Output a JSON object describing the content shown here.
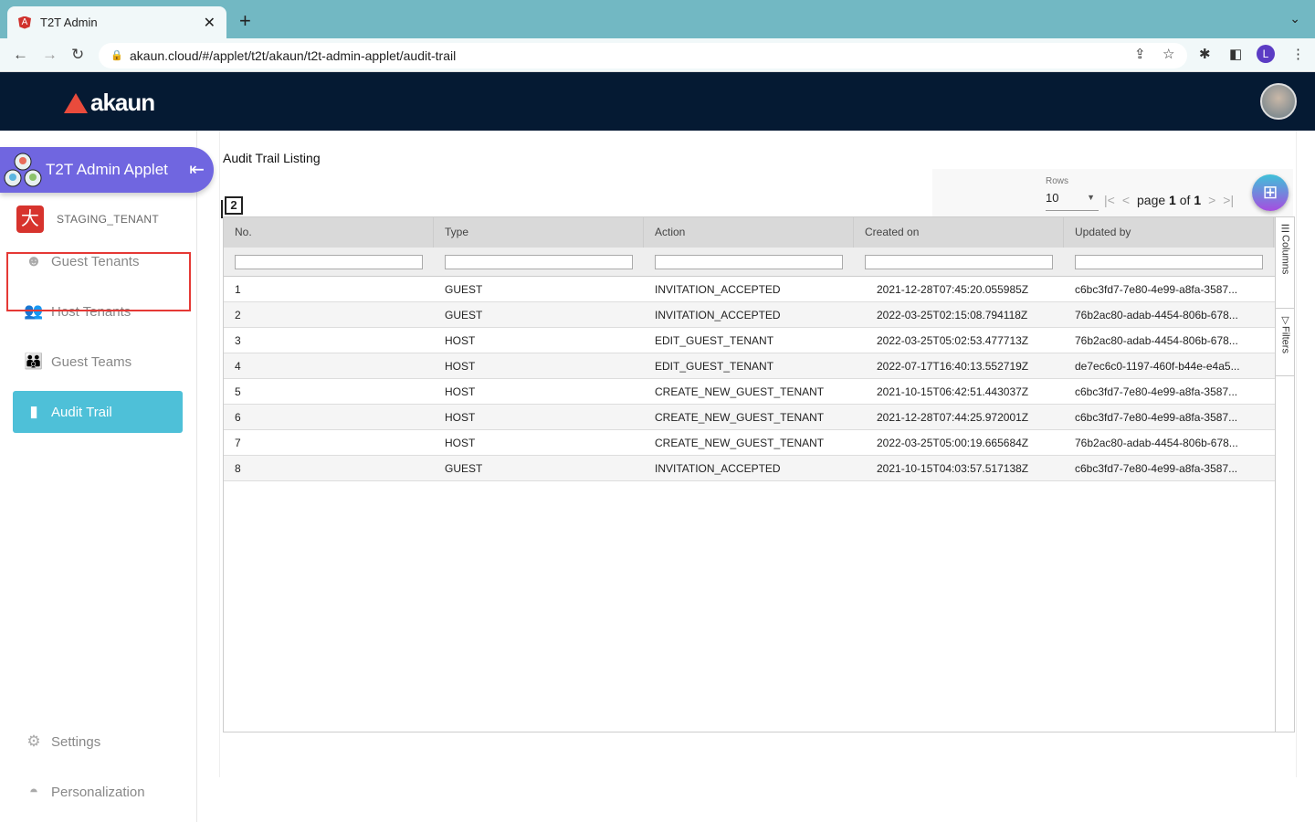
{
  "browser": {
    "tab_title": "T2T Admin",
    "url": "akaun.cloud/#/applet/t2t/akaun/t2t-admin-applet/audit-trail",
    "profile_initial": "L"
  },
  "header": {
    "logo_text": "akaun"
  },
  "sidebar": {
    "applet_title": "T2T Admin Applet",
    "tenant": "STAGING_TENANT",
    "items": [
      {
        "label": "Guest Tenants"
      },
      {
        "label": "Host Tenants"
      },
      {
        "label": "Guest Teams"
      },
      {
        "label": "Audit Trail"
      }
    ],
    "bottom": [
      {
        "label": "Settings"
      },
      {
        "label": "Personalization"
      }
    ]
  },
  "main": {
    "title": "Audit Trail Listing",
    "record_count": "2",
    "pager": {
      "rows_label": "Rows",
      "rows_value": "10",
      "page_label": "page",
      "page": "1",
      "of_label": "of",
      "total_pages": "1"
    },
    "columns": [
      "No.",
      "Type",
      "Action",
      "Created on",
      "Updated by"
    ],
    "side_panel": {
      "columns": "Columns",
      "filters": "Filters"
    },
    "rows": [
      [
        "1",
        "GUEST",
        "INVITATION_ACCEPTED",
        "2021-12-28T07:45:20.055985Z",
        "c6bc3fd7-7e80-4e99-a8fa-3587..."
      ],
      [
        "2",
        "GUEST",
        "INVITATION_ACCEPTED",
        "2022-03-25T02:15:08.794118Z",
        "76b2ac80-adab-4454-806b-678..."
      ],
      [
        "3",
        "HOST",
        "EDIT_GUEST_TENANT",
        "2022-03-25T05:02:53.477713Z",
        "76b2ac80-adab-4454-806b-678..."
      ],
      [
        "4",
        "HOST",
        "EDIT_GUEST_TENANT",
        "2022-07-17T16:40:13.552719Z",
        "de7ec6c0-1197-460f-b44e-e4a5..."
      ],
      [
        "5",
        "HOST",
        "CREATE_NEW_GUEST_TENANT",
        "2021-10-15T06:42:51.443037Z",
        "c6bc3fd7-7e80-4e99-a8fa-3587..."
      ],
      [
        "6",
        "HOST",
        "CREATE_NEW_GUEST_TENANT",
        "2021-12-28T07:44:25.972001Z",
        "c6bc3fd7-7e80-4e99-a8fa-3587..."
      ],
      [
        "7",
        "HOST",
        "CREATE_NEW_GUEST_TENANT",
        "2022-03-25T05:00:19.665684Z",
        "76b2ac80-adab-4454-806b-678..."
      ],
      [
        "8",
        "GUEST",
        "INVITATION_ACCEPTED",
        "2021-10-15T04:03:57.517138Z",
        "c6bc3fd7-7e80-4e99-a8fa-3587..."
      ]
    ]
  }
}
